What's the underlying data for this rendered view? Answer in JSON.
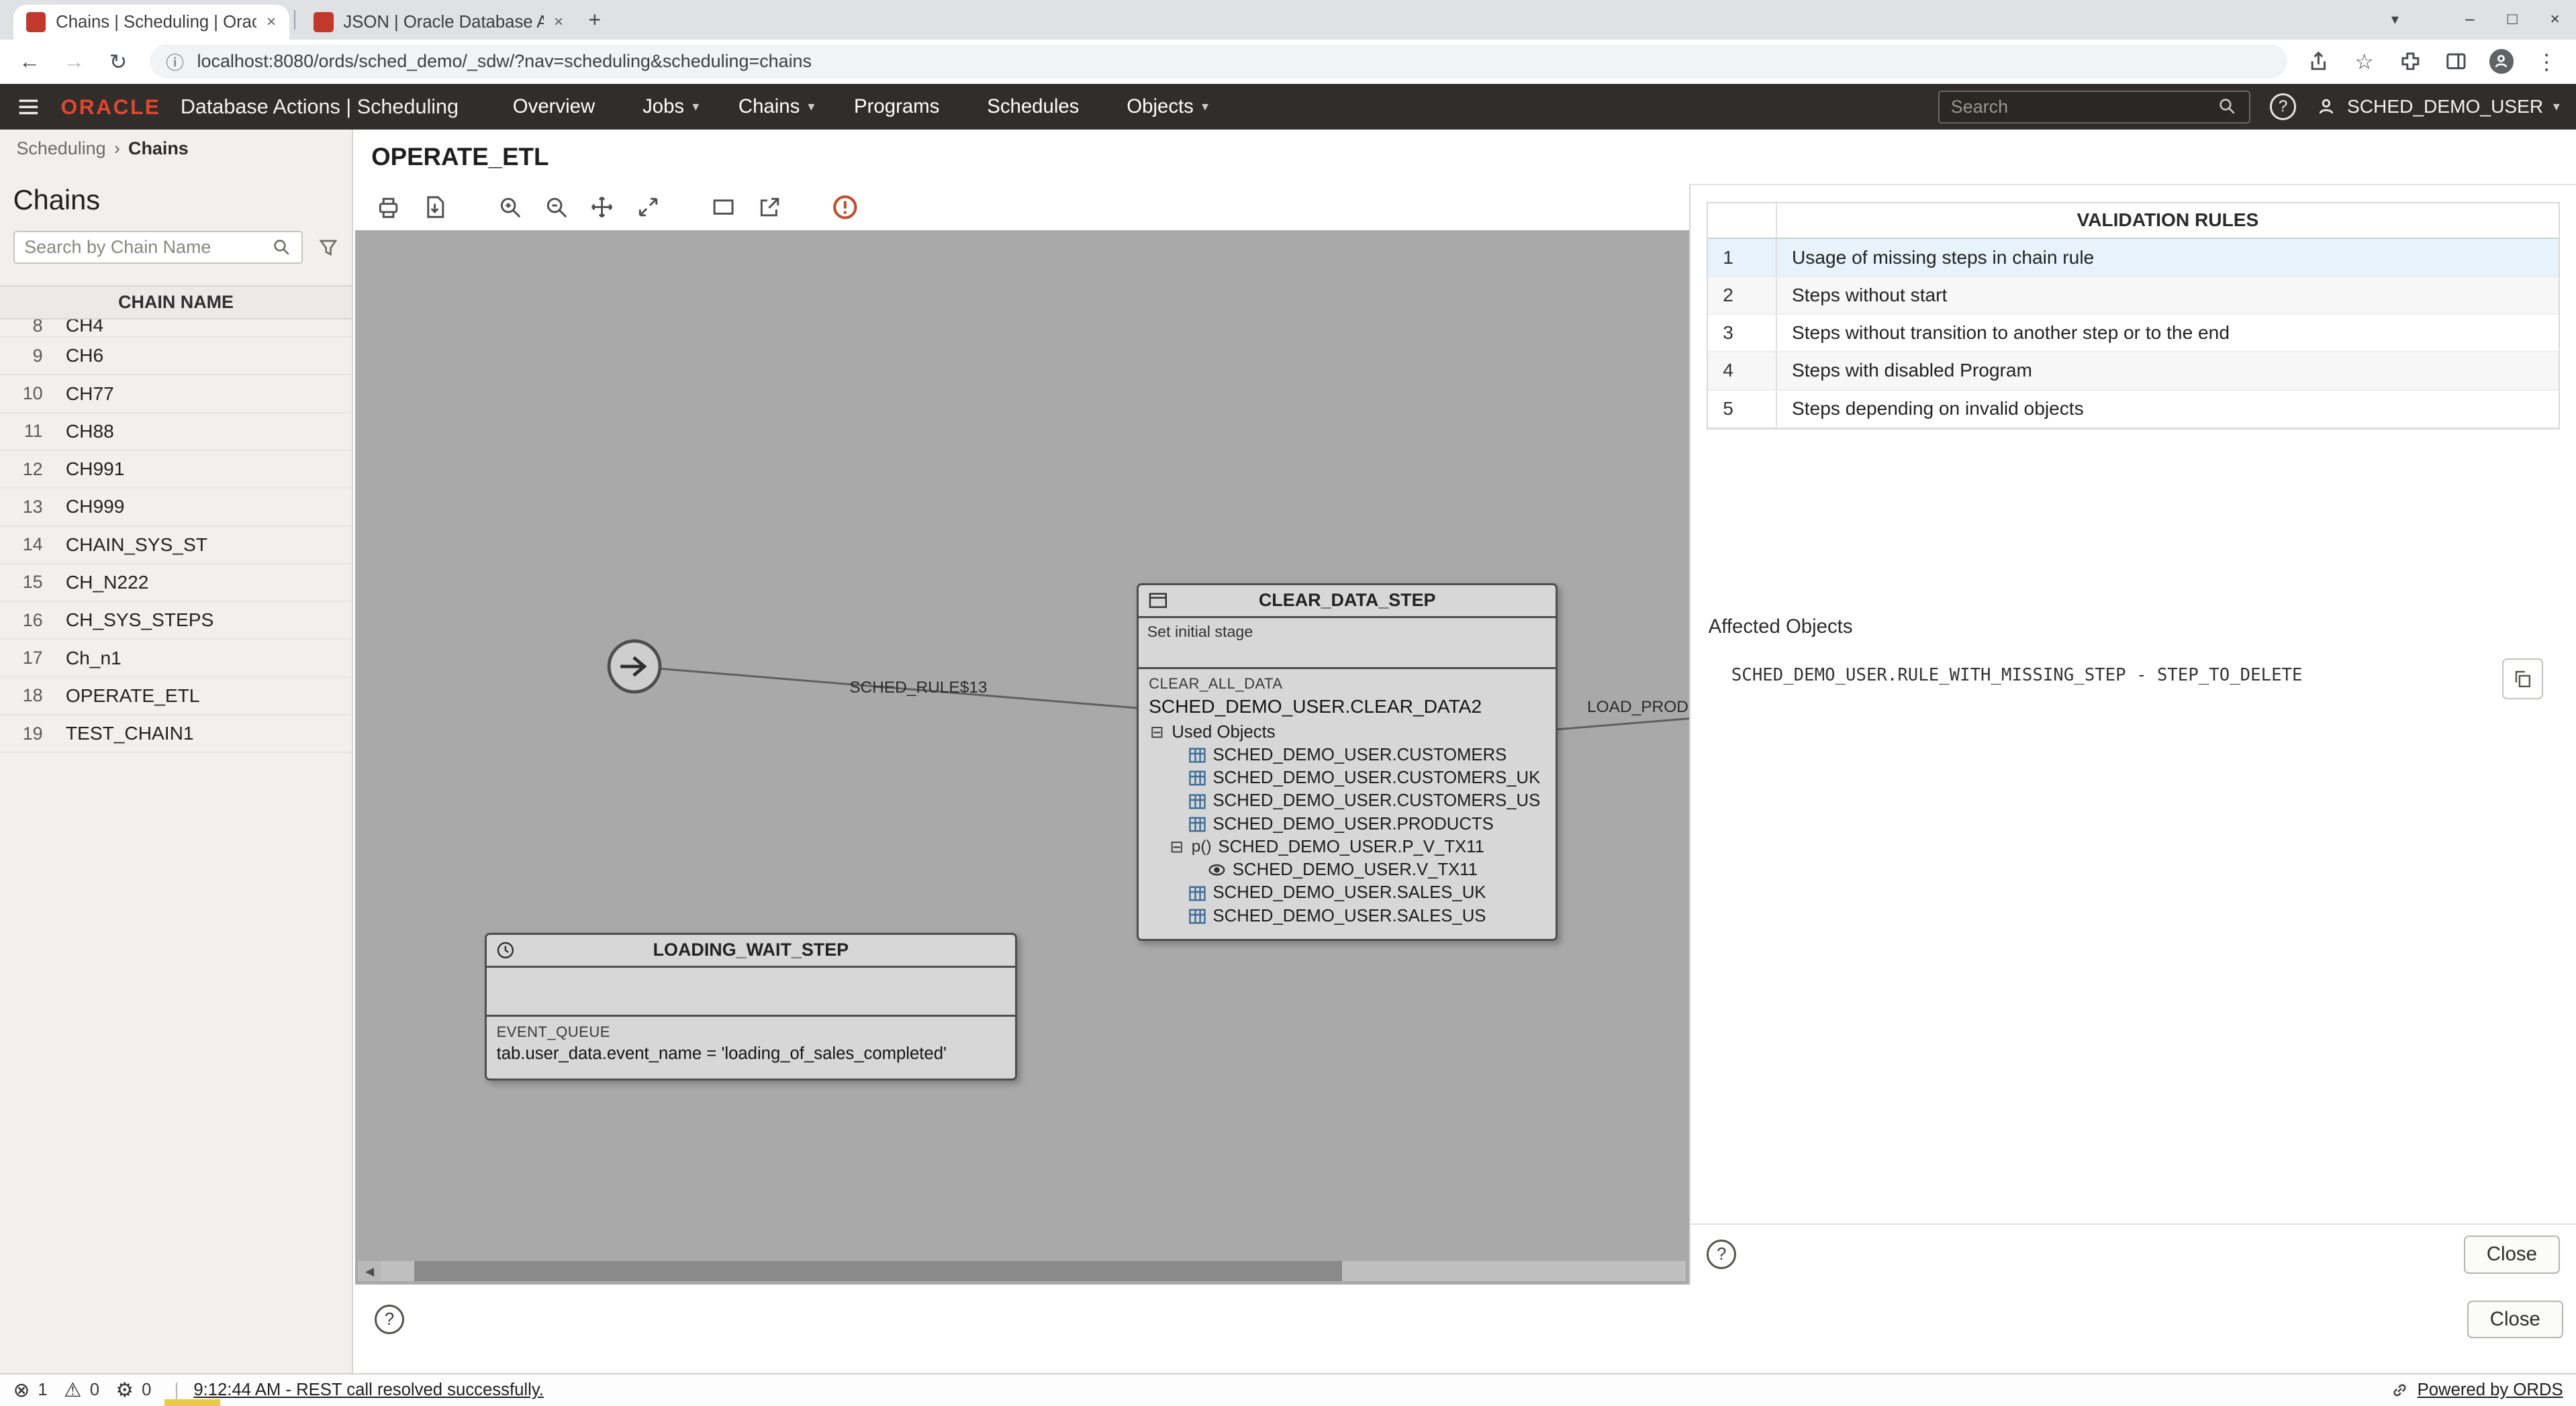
{
  "browser": {
    "tabs": [
      {
        "title": "Chains | Scheduling | Oracle Dat"
      },
      {
        "title": "JSON | Oracle Database Actions"
      }
    ],
    "tab_close": "×",
    "new_tab_label": "+",
    "window_controls": {
      "tab_search": "▾",
      "minimize": "–",
      "maximize": "□",
      "close": "×"
    },
    "toolbar": {
      "back": "←",
      "forward": "→",
      "reload": "↻",
      "info": "ⓘ",
      "star": "☆",
      "menu": "⋮"
    },
    "url": "localhost:8080/ords/sched_demo/_sdw/?nav=scheduling&scheduling=chains"
  },
  "navbar": {
    "brand": "ORACLE",
    "app_title": "Database Actions | Scheduling",
    "items": [
      {
        "label": "Overview",
        "caret": ""
      },
      {
        "label": "Jobs",
        "caret": "▾"
      },
      {
        "label": "Chains",
        "caret": "▾"
      },
      {
        "label": "Programs",
        "caret": ""
      },
      {
        "label": "Schedules",
        "caret": ""
      },
      {
        "label": "Objects",
        "caret": "▾"
      }
    ],
    "search_placeholder": "Search",
    "help": "?",
    "user": "SCHED_DEMO_USER",
    "user_caret": "▾"
  },
  "breadcrumb": {
    "parent": "Scheduling",
    "separator": "›",
    "current": "Chains"
  },
  "sidebar": {
    "title": "Chains",
    "search_placeholder": "Search by Chain Name",
    "column_header": "CHAIN NAME",
    "rows": [
      {
        "num": "8",
        "name": "CH4"
      },
      {
        "num": "9",
        "name": "CH6"
      },
      {
        "num": "10",
        "name": "CH77"
      },
      {
        "num": "11",
        "name": "CH88"
      },
      {
        "num": "12",
        "name": "CH991"
      },
      {
        "num": "13",
        "name": "CH999"
      },
      {
        "num": "14",
        "name": "CHAIN_SYS_ST"
      },
      {
        "num": "15",
        "name": "CH_N222"
      },
      {
        "num": "16",
        "name": "CH_SYS_STEPS"
      },
      {
        "num": "17",
        "name": "Ch_n1"
      },
      {
        "num": "18",
        "name": "OPERATE_ETL"
      },
      {
        "num": "19",
        "name": "TEST_CHAIN1"
      }
    ]
  },
  "main": {
    "title": "OPERATE_ETL",
    "close_label": "Close",
    "help": "?"
  },
  "diagram": {
    "edges": [
      {
        "label": "SCHED_RULE$13"
      },
      {
        "label": "LOAD_PRODUCT_"
      }
    ],
    "clear_step": {
      "title": "CLEAR_DATA_STEP",
      "stage_note": "Set initial stage",
      "section_label": "CLEAR_ALL_DATA",
      "program": "SCHED_DEMO_USER.CLEAR_DATA2",
      "expander": "⊟",
      "tree_root": "Used Objects",
      "objects": [
        {
          "label": "SCHED_DEMO_USER.CUSTOMERS"
        },
        {
          "label": "SCHED_DEMO_USER.CUSTOMERS_UK"
        },
        {
          "label": "SCHED_DEMO_USER.CUSTOMERS_US"
        },
        {
          "label": "SCHED_DEMO_USER.PRODUCTS"
        },
        {
          "label": "SCHED_DEMO_USER.P_V_TX11",
          "prefix": "p()",
          "expander": "⊟"
        },
        {
          "label": "SCHED_DEMO_USER.V_TX11"
        },
        {
          "label": "SCHED_DEMO_USER.SALES_UK"
        },
        {
          "label": "SCHED_DEMO_USER.SALES_US"
        }
      ]
    },
    "wait_step": {
      "title": "LOADING_WAIT_STEP",
      "section_label": "EVENT_QUEUE",
      "condition": "tab.user_data.event_name = 'loading_of_sales_completed'"
    },
    "scroll_arrow": "◀"
  },
  "validation": {
    "header": "VALIDATION RULES",
    "rules": [
      {
        "num": "1",
        "text": "Usage of missing steps in chain rule"
      },
      {
        "num": "2",
        "text": "Steps without start"
      },
      {
        "num": "3",
        "text": "Steps without transition to another step or to the end"
      },
      {
        "num": "4",
        "text": "Steps with disabled Program"
      },
      {
        "num": "5",
        "text": "Steps depending on invalid objects"
      }
    ],
    "affected_label": "Affected Objects",
    "affected_value": "SCHED_DEMO_USER.RULE_WITH_MISSING_STEP - STEP_TO_DELETE",
    "close_label": "Close",
    "help": "?"
  },
  "statusbar": {
    "error_icon": "⊗",
    "error_count": "1",
    "warning_icon": "⚠",
    "warning_count": "0",
    "settings_icon": "⚙",
    "settings_count": "0",
    "divider": "|",
    "message": "9:12:44 AM - REST call resolved successfully.",
    "powered_by": "Powered by ORDS"
  },
  "colors": {
    "accent_red": "#c74634",
    "navbar_bg": "#312d2a",
    "canvas_bg": "#a9a9a9",
    "selected_row": "#e7f2fa"
  }
}
